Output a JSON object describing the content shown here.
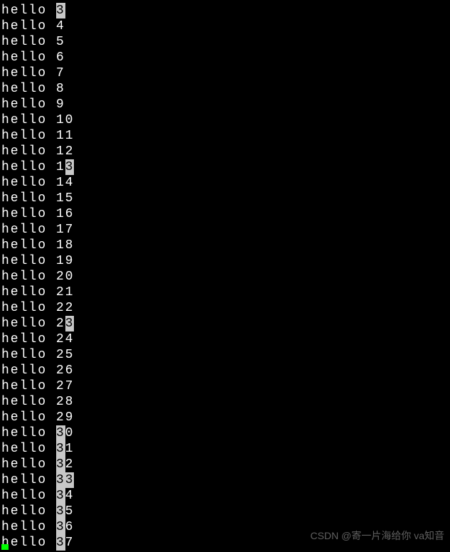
{
  "terminal": {
    "prefix": "hello ",
    "lines": [
      {
        "pre": "",
        "hl": "3",
        "post": ""
      },
      {
        "pre": "4",
        "hl": "",
        "post": ""
      },
      {
        "pre": "5",
        "hl": "",
        "post": ""
      },
      {
        "pre": "6",
        "hl": "",
        "post": ""
      },
      {
        "pre": "7",
        "hl": "",
        "post": ""
      },
      {
        "pre": "8",
        "hl": "",
        "post": ""
      },
      {
        "pre": "9",
        "hl": "",
        "post": ""
      },
      {
        "pre": "10",
        "hl": "",
        "post": ""
      },
      {
        "pre": "11",
        "hl": "",
        "post": ""
      },
      {
        "pre": "12",
        "hl": "",
        "post": ""
      },
      {
        "pre": "1",
        "hl": "3",
        "post": ""
      },
      {
        "pre": "14",
        "hl": "",
        "post": ""
      },
      {
        "pre": "15",
        "hl": "",
        "post": ""
      },
      {
        "pre": "16",
        "hl": "",
        "post": ""
      },
      {
        "pre": "17",
        "hl": "",
        "post": ""
      },
      {
        "pre": "18",
        "hl": "",
        "post": ""
      },
      {
        "pre": "19",
        "hl": "",
        "post": ""
      },
      {
        "pre": "20",
        "hl": "",
        "post": ""
      },
      {
        "pre": "21",
        "hl": "",
        "post": ""
      },
      {
        "pre": "22",
        "hl": "",
        "post": ""
      },
      {
        "pre": "2",
        "hl": "3",
        "post": ""
      },
      {
        "pre": "24",
        "hl": "",
        "post": ""
      },
      {
        "pre": "25",
        "hl": "",
        "post": ""
      },
      {
        "pre": "26",
        "hl": "",
        "post": ""
      },
      {
        "pre": "27",
        "hl": "",
        "post": ""
      },
      {
        "pre": "28",
        "hl": "",
        "post": ""
      },
      {
        "pre": "29",
        "hl": "",
        "post": ""
      },
      {
        "pre": "",
        "hl": "3",
        "post": "0"
      },
      {
        "pre": "",
        "hl": "3",
        "post": "1"
      },
      {
        "pre": "",
        "hl": "3",
        "post": "2"
      },
      {
        "pre": "",
        "hl": "33",
        "post": ""
      },
      {
        "pre": "",
        "hl": "3",
        "post": "4"
      },
      {
        "pre": "",
        "hl": "3",
        "post": "5"
      },
      {
        "pre": "",
        "hl": "3",
        "post": "6"
      },
      {
        "pre": "",
        "hl": "3",
        "post": "7"
      }
    ]
  },
  "watermark": "CSDN @寄一片海给你   va知音"
}
